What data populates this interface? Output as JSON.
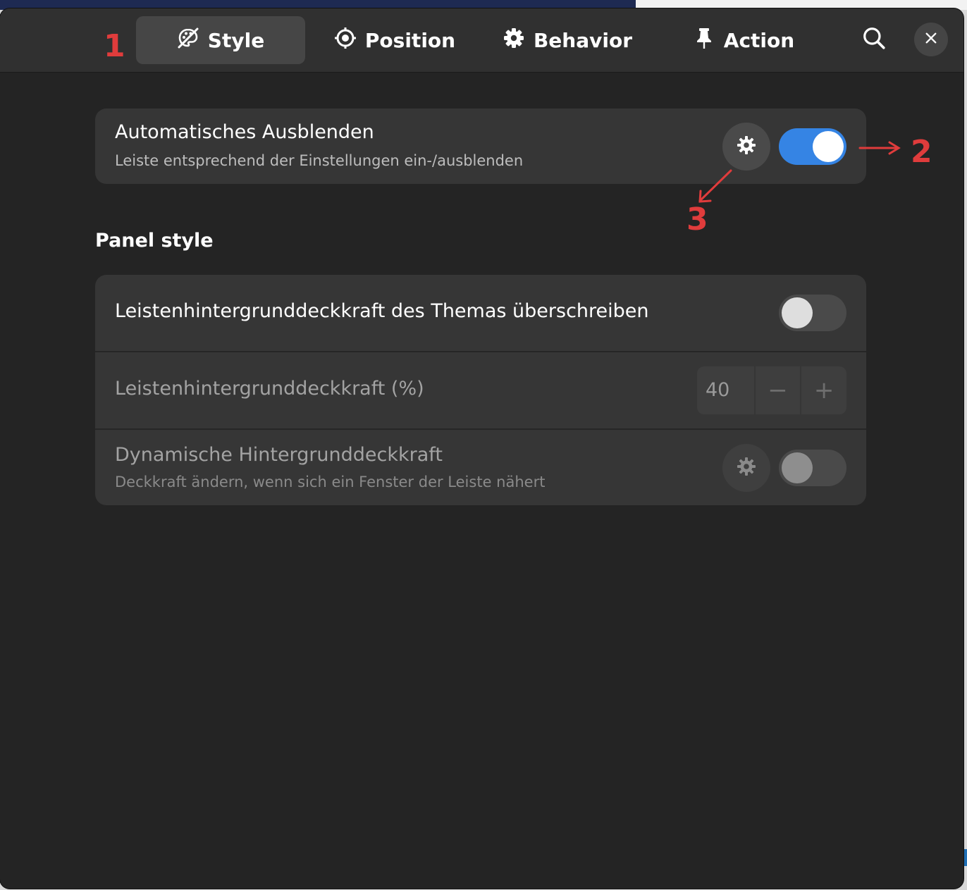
{
  "tabs": [
    {
      "label": "Style",
      "icon": "palette-icon",
      "active": true
    },
    {
      "label": "Position",
      "icon": "crosshair-icon",
      "active": false
    },
    {
      "label": "Behavior",
      "icon": "gear-icon",
      "active": false
    },
    {
      "label": "Action",
      "icon": "pin-icon",
      "active": false
    }
  ],
  "header": {
    "search_icon": "search-icon",
    "close_icon": "close-icon"
  },
  "autohide": {
    "title": "Automatisches Ausblenden",
    "subtitle": "Leiste entsprechend der Einstellungen ein-/ausblenden",
    "enabled": true
  },
  "panel_style": {
    "heading": "Panel style",
    "override": {
      "title": "Leistenhintergrunddeckkraft des Themas überschreiben",
      "enabled": false
    },
    "opacity": {
      "title": "Leistenhintergrunddeckkraft (%)",
      "value": "40",
      "minus": "−",
      "plus": "+"
    },
    "dynamic": {
      "title": "Dynamische Hintergrunddeckkraft",
      "subtitle": "Deckkraft ändern, wenn sich ein Fenster der Leiste nähert",
      "enabled": false
    }
  },
  "annotations": {
    "one": "1",
    "two": "2",
    "three": "3"
  },
  "colors": {
    "accent": "#3584e4",
    "annotation": "#e03c3c",
    "window_bg": "#242424",
    "card_bg": "#363636"
  }
}
